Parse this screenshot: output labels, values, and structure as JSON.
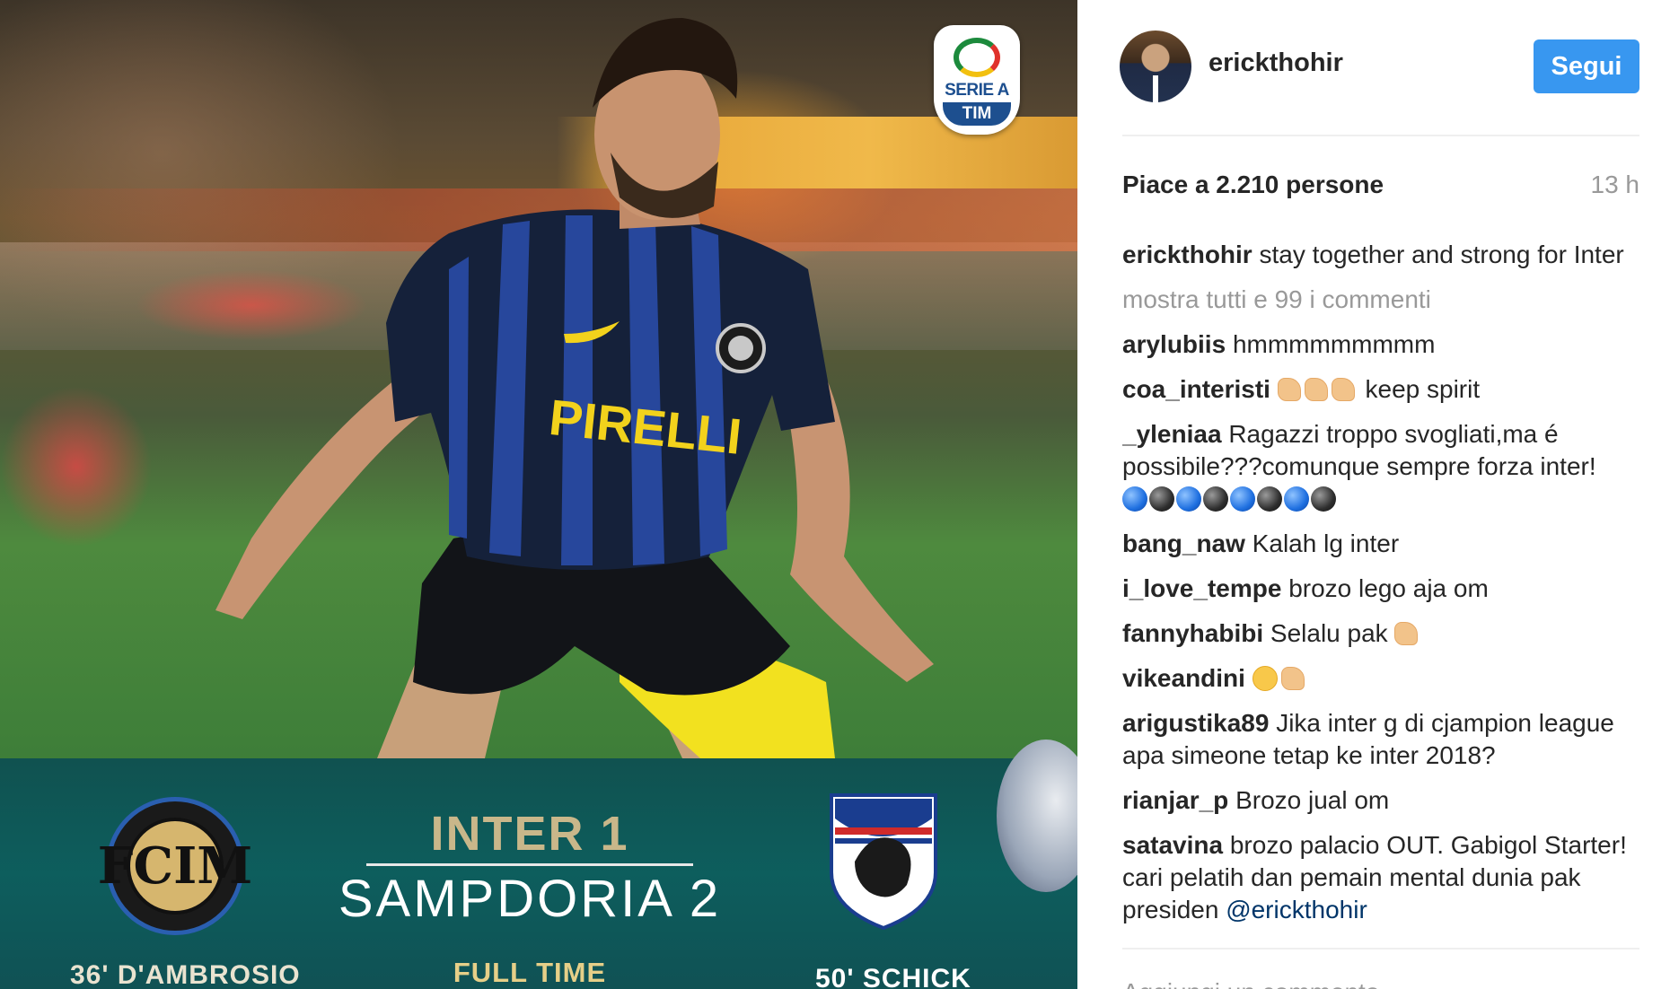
{
  "photo": {
    "league_badge": {
      "name": "SERIE A",
      "sponsor": "TIM"
    },
    "score": {
      "line1": "INTER 1",
      "line2": "SAMPDORIA 2",
      "status": "FULL TIME",
      "scorer_home": "36' D'AMBROSIO",
      "scorer_away": "50' SCHICK"
    },
    "jersey_sponsor": "PIRELLI"
  },
  "header": {
    "username": "erickthohir",
    "follow_label": "Segui"
  },
  "post": {
    "likes_text": "Piace a 2.210 persone",
    "time_text": "13 h",
    "caption": {
      "user": "erickthohir",
      "text": "stay together and strong for Inter"
    },
    "show_all_text": "mostra tutti e 99 i commenti",
    "comments": [
      {
        "user": "arylubiis",
        "text": "hmmmmmmmmm"
      },
      {
        "user": "coa_interisti",
        "text": "keep spirit",
        "emoji": "flexed-biceps x3"
      },
      {
        "user": "_yleniaa",
        "text": "Ragazzi troppo svogliati,ma é possibile???comunque sempre forza inter!",
        "emoji": "blue-black circles x8"
      },
      {
        "user": "bang_naw",
        "text": "Kalah lg inter"
      },
      {
        "user": "i_love_tempe",
        "text": "brozo lego aja om"
      },
      {
        "user": "fannyhabibi",
        "text": "Selalu pak",
        "emoji": "flexed-biceps"
      },
      {
        "user": "vikeandini",
        "text": "",
        "emoji": "pensive-face, flexed-biceps"
      },
      {
        "user": "arigustika89",
        "text": "Jika inter g di cjampion league apa simeone tetap ke inter 2018?"
      },
      {
        "user": "rianjar_p",
        "text": "Brozo jual om"
      },
      {
        "user": "satavina",
        "text": "brozo palacio OUT. Gabigol Starter! cari pelatih dan pemain mental dunia pak presiden",
        "mention": "@erickthohir"
      }
    ],
    "add_comment_placeholder": "Aggiungi un commento..."
  },
  "colors": {
    "follow_button": "#3897f0",
    "username_text": "#262626",
    "muted_text": "#999999",
    "mention": "#003569",
    "score_band": "#0c5a5e"
  },
  "icons": [
    "avatar-image",
    "serie-a-logo",
    "inter-logo",
    "sampdoria-logo"
  ]
}
